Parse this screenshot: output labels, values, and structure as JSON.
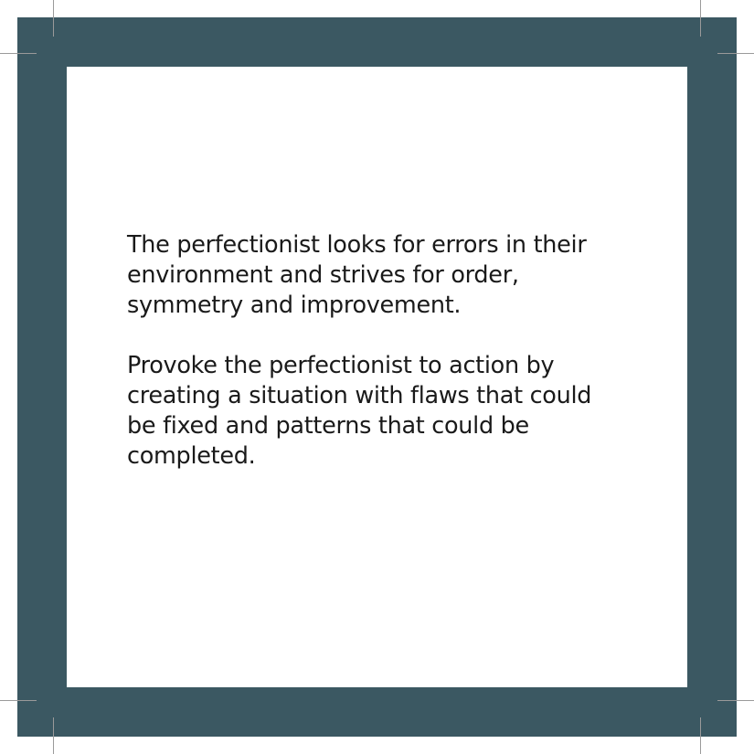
{
  "card": {
    "paragraph_1": "The perfectionist looks for errors in their\nenvironment and strives for order,\nsymmetry and improvement.",
    "paragraph_2": "Provoke the perfectionist to action by\ncreating a situation with flaws that could\nbe fixed and patterns that could be\ncompleted."
  },
  "colors": {
    "frame": "#3b5862",
    "panel": "#ffffff",
    "text": "#1a1a1a",
    "crop_marks": "#9a9a9a"
  }
}
